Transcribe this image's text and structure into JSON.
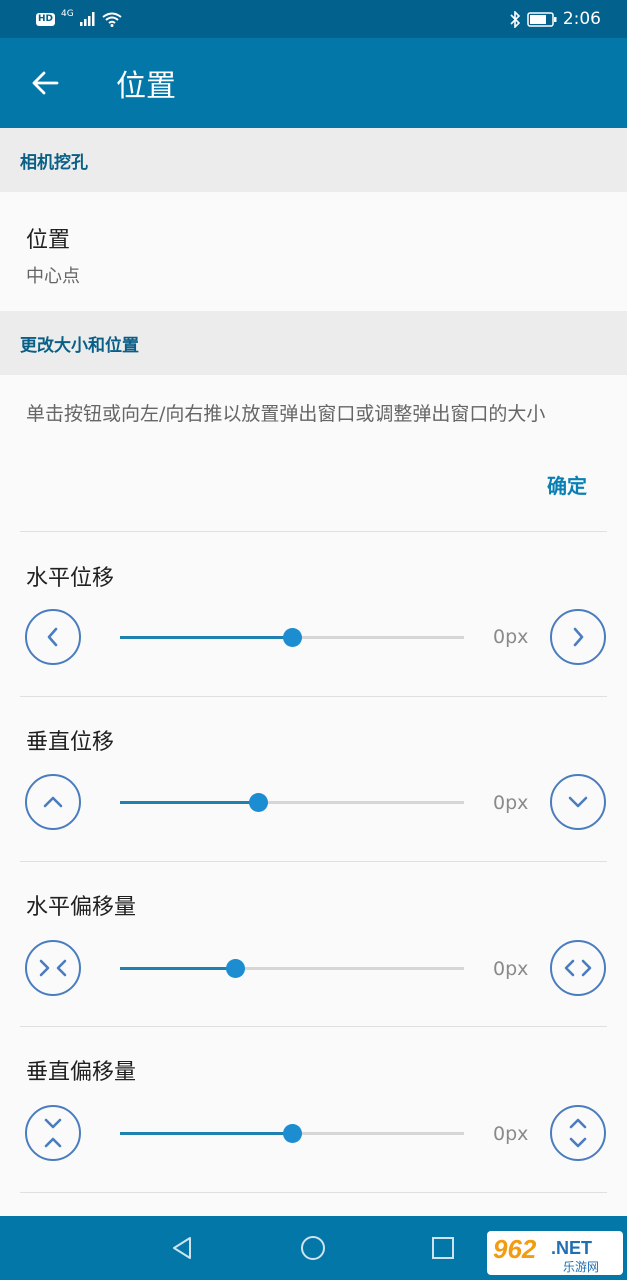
{
  "status_bar": {
    "hd": "HD",
    "network": "4G",
    "time": "2:06"
  },
  "app_bar": {
    "title": "位置"
  },
  "sections": {
    "camera_cutout": "相机挖孔",
    "resize_position": "更改大小和位置"
  },
  "position_pref": {
    "title": "位置",
    "summary": "中心点"
  },
  "description": "单击按钮或向左/向右推以放置弹出窗口或调整弹出窗口的大小",
  "confirm_label": "确定",
  "controls": [
    {
      "title": "水平位移",
      "value": "0px",
      "slider_fraction": 0.5,
      "left_icon": "chevron-left-icon",
      "right_icon": "chevron-right-icon"
    },
    {
      "title": "垂直位移",
      "value": "0px",
      "slider_fraction": 0.4,
      "left_icon": "chevron-up-icon",
      "right_icon": "chevron-down-icon"
    },
    {
      "title": "水平偏移量",
      "value": "0px",
      "slider_fraction": 0.333,
      "left_icon": "compress-horizontal-icon",
      "right_icon": "expand-horizontal-icon"
    },
    {
      "title": "垂直偏移量",
      "value": "0px",
      "slider_fraction": 0.5,
      "left_icon": "compress-vertical-icon",
      "right_icon": "expand-vertical-icon"
    }
  ],
  "watermark": {
    "number": "962",
    "net": ".NET",
    "cn": "乐游网"
  },
  "colors": {
    "app_bar": "#0477a9",
    "status_bar": "#03618d",
    "accent": "#1c8dd0",
    "section_text": "#0a5f87"
  }
}
